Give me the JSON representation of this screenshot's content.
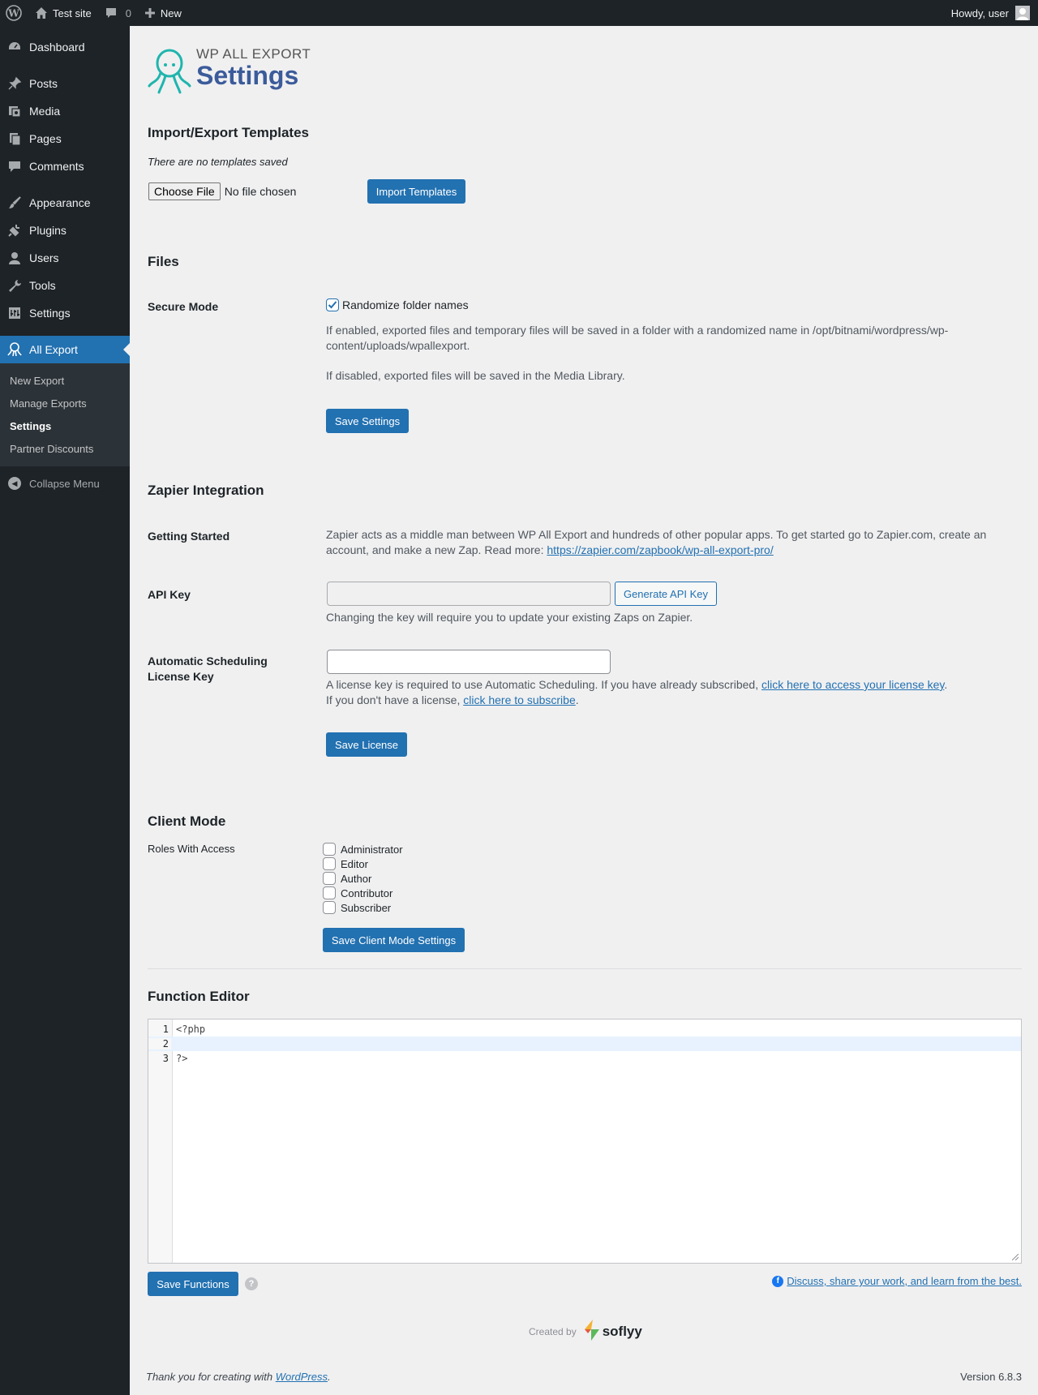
{
  "adminbar": {
    "site_name": "Test site",
    "comments_count": "0",
    "new_label": "New",
    "howdy": "Howdy, user"
  },
  "sidebar": {
    "items": [
      {
        "label": "Dashboard",
        "icon": "dashboard-icon"
      },
      {
        "label": "Posts",
        "icon": "pin-icon"
      },
      {
        "label": "Media",
        "icon": "media-icon"
      },
      {
        "label": "Pages",
        "icon": "pages-icon"
      },
      {
        "label": "Comments",
        "icon": "comment-icon"
      },
      {
        "label": "Appearance",
        "icon": "brush-icon"
      },
      {
        "label": "Plugins",
        "icon": "plugin-icon"
      },
      {
        "label": "Users",
        "icon": "user-icon"
      },
      {
        "label": "Tools",
        "icon": "wrench-icon"
      },
      {
        "label": "Settings",
        "icon": "settings-icon"
      },
      {
        "label": "All Export",
        "icon": "octopus-icon"
      }
    ],
    "submenu": [
      "New Export",
      "Manage Exports",
      "Settings",
      "Partner Discounts"
    ],
    "collapse_label": "Collapse Menu"
  },
  "logo": {
    "small": "WP ALL EXPORT",
    "big": "Settings"
  },
  "templates": {
    "heading": "Import/Export Templates",
    "empty_note": "There are no templates saved",
    "choose_file": "Choose File",
    "no_file": "No file chosen",
    "import_button": "Import Templates"
  },
  "files": {
    "heading": "Files",
    "secure_mode_label": "Secure Mode",
    "randomize_label": "Randomize folder names",
    "randomize_checked": true,
    "desc_enabled": "If enabled, exported files and temporary files will be saved in a folder with a randomized name in /opt/bitnami/wordpress/wp-content/uploads/wpallexport.",
    "desc_disabled": "If disabled, exported files will be saved in the Media Library.",
    "save_button": "Save Settings"
  },
  "zapier": {
    "heading": "Zapier Integration",
    "getting_started_label": "Getting Started",
    "getting_started_text": "Zapier acts as a middle man between WP All Export and hundreds of other popular apps. To get started go to Zapier.com, create an account, and make a new Zap. Read more: ",
    "getting_started_link": "https://zapier.com/zapbook/wp-all-export-pro/",
    "api_key_label": "API Key",
    "api_key_value": "",
    "generate_button": "Generate API Key",
    "api_key_note": "Changing the key will require you to update your existing Zaps on Zapier.",
    "license_label": "Automatic Scheduling License Key",
    "license_value": "",
    "license_note_1": "A license key is required to use Automatic Scheduling. If you have already subscribed, ",
    "license_link_1": "click here to access your license key",
    "license_note_2": "If you don't have a license, ",
    "license_link_2": "click here to subscribe",
    "save_license_button": "Save License"
  },
  "client_mode": {
    "heading": "Client Mode",
    "roles_label": "Roles With Access",
    "roles": [
      "Administrator",
      "Editor",
      "Author",
      "Contributor",
      "Subscriber"
    ],
    "save_button": "Save Client Mode Settings"
  },
  "function_editor": {
    "heading": "Function Editor",
    "lines": [
      {
        "num": "1",
        "code": "<?php"
      },
      {
        "num": "2",
        "code": ""
      },
      {
        "num": "3",
        "code": "?>"
      }
    ],
    "save_button": "Save Functions",
    "discuss_link": "Discuss, share your work, and learn from the best."
  },
  "credit": {
    "created_by": "Created by",
    "brand": "soflyy"
  },
  "footer": {
    "thanks": "Thank you for creating with ",
    "wp_link": "WordPress",
    "version": "Version 6.8.3"
  },
  "colors": {
    "accent": "#2271b1",
    "sidebar_bg": "#1d2327",
    "logo_teal": "#1fb5ad",
    "logo_blue": "#3b5b9a"
  }
}
